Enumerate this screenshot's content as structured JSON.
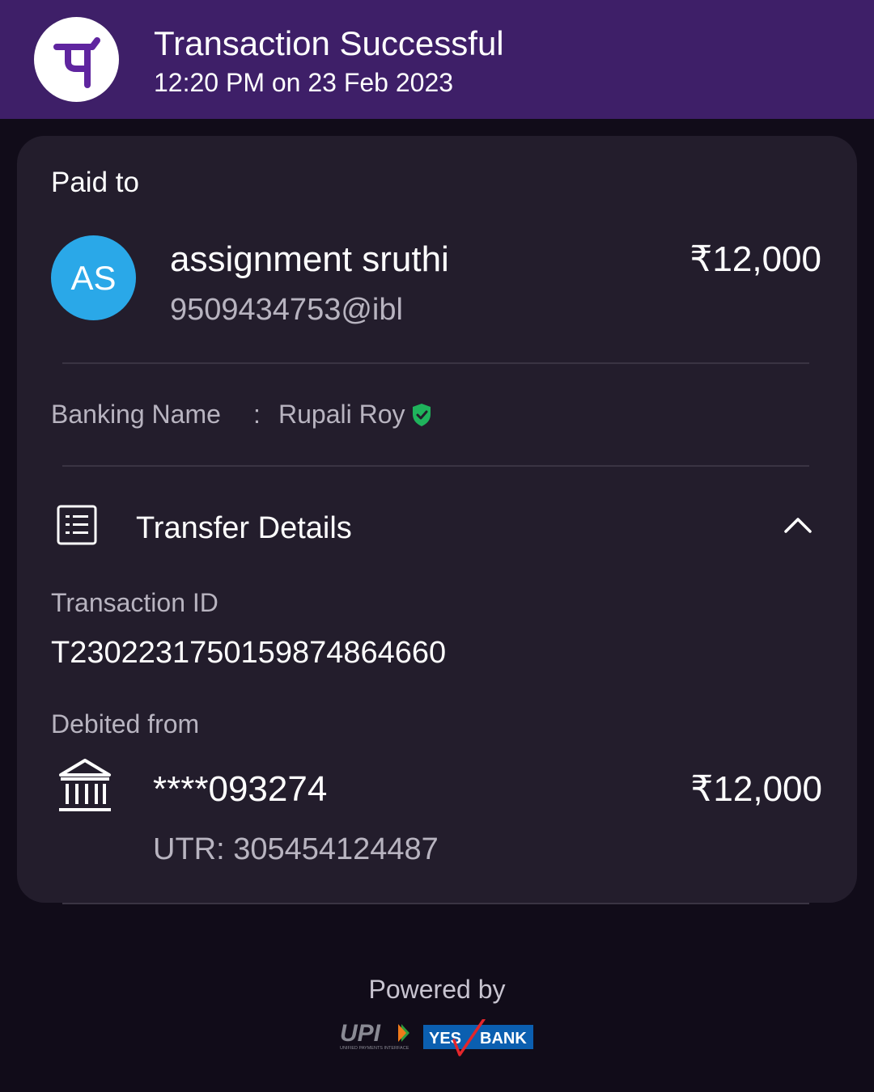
{
  "header": {
    "title": "Transaction Successful",
    "datetime": "12:20 PM on 23 Feb 2023",
    "logo_icon": "phonepe-logo",
    "bg_color": "#3e1f68"
  },
  "payee": {
    "section_label": "Paid to",
    "initials": "AS",
    "name": "assignment sruthi",
    "vpa": "9509434753@ibl",
    "amount": "₹12,000",
    "avatar_color": "#2aa8e8"
  },
  "banking": {
    "label": "Banking Name",
    "separator": ":",
    "name": "Rupali Roy",
    "verified_icon": "verified-shield-icon"
  },
  "transfer_details": {
    "title": "Transfer Details",
    "expanded": true,
    "transaction_id_label": "Transaction ID",
    "transaction_id": "T2302231750159874864660",
    "debited_from_label": "Debited from",
    "account": "****093274",
    "amount": "₹12,000",
    "utr": "UTR: 305454124487"
  },
  "footer": {
    "powered_by": "Powered by",
    "upi_logo_text": "UPI",
    "upi_tagline": "UNIFIED PAYMENTS INTERFACE",
    "bank_logo_left": "YES",
    "bank_logo_right": "BANK"
  }
}
